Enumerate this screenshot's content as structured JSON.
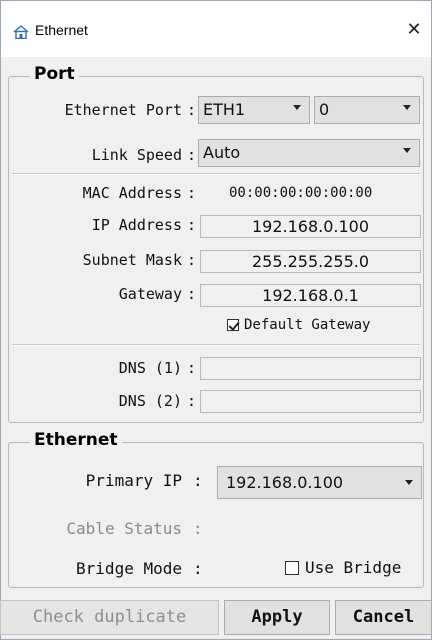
{
  "window": {
    "title": "Ethernet",
    "close_glyph": "✕",
    "icon": "home-icon"
  },
  "port": {
    "legend": "Port",
    "ethernet_port": {
      "label": "Ethernet Port",
      "value": "ETH1",
      "index_value": "0"
    },
    "link_speed": {
      "label": "Link Speed",
      "value": "Auto"
    },
    "mac_address": {
      "label": "MAC Address",
      "value": "00:00:00:00:00:00"
    },
    "ip_address": {
      "label": "IP Address",
      "value": "192.168.0.100"
    },
    "subnet_mask": {
      "label": "Subnet Mask",
      "value": "255.255.255.0"
    },
    "gateway": {
      "label": "Gateway",
      "value": "192.168.0.1"
    },
    "default_gateway": {
      "label": "Default Gateway",
      "checked": true
    },
    "dns1": {
      "label": "DNS (1)",
      "value": ""
    },
    "dns2": {
      "label": "DNS (2)",
      "value": ""
    }
  },
  "ethernet": {
    "legend": "Ethernet",
    "primary_ip": {
      "label": "Primary IP",
      "value": "192.168.0.100"
    },
    "cable_status": {
      "label": "Cable Status"
    },
    "bridge_mode": {
      "label": "Bridge Mode"
    },
    "use_bridge": {
      "label": "Use Bridge",
      "checked": false
    }
  },
  "buttons": {
    "check_duplicate": "Check duplicate",
    "apply": "Apply",
    "cancel": "Cancel"
  },
  "colon": ":"
}
